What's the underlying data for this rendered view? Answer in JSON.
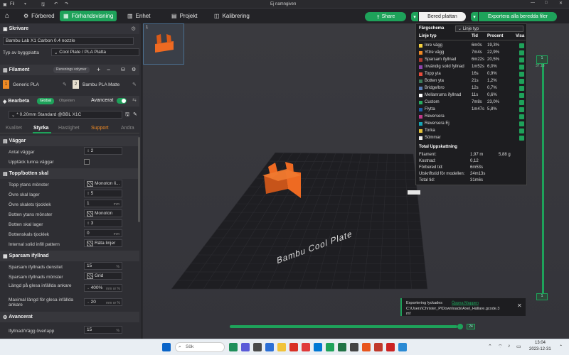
{
  "titlebar": {
    "menu": "Fil",
    "title": "Ej namngiven"
  },
  "toolbar": {
    "prepare": "Förbered",
    "preview": "Förhandsvisning",
    "device": "Enhet",
    "project": "Projekt",
    "calibration": "Kalibrering",
    "share": "Share",
    "slice": "Bered plattan",
    "export": "Exportera alla beredda filer"
  },
  "printer": {
    "header": "Skrivare",
    "model": "Bambu Lab X1 Carbon 0.4 nozzle",
    "plate_label": "Typ av byggplatta",
    "plate_value": "Cool Plate / PLA Platta"
  },
  "filament": {
    "header": "Filament",
    "flush_btn": "Rensnings volymer",
    "slots": [
      {
        "num": "1",
        "name": "Generic PLA",
        "color": "#f08a24"
      },
      {
        "num": "2",
        "name": "Bambu PLA Matte",
        "color": "#e8e0d0"
      }
    ]
  },
  "process": {
    "header": "Bearbeta",
    "global": "Global",
    "objects": "Objekten",
    "advanced": "Avancerat",
    "profile": "* 0.20mm Standard @BBL X1C",
    "tabs": [
      "Kvalitet",
      "Styrka",
      "Hastighet",
      "Support",
      "Andra"
    ]
  },
  "settings": {
    "walls": {
      "header": "Väggar",
      "wall_count_label": "Antal väggar",
      "wall_count": "2",
      "detect_thin_label": "Upptäck tunna väggar"
    },
    "topbottom": {
      "header": "Topp/botten skal",
      "top_pattern_label": "Topp ytans mönster",
      "top_pattern": "Monoton li...",
      "top_layers_label": "Övre skal lager",
      "top_layers": "5",
      "top_thick_label": "Övre skalets tjocklek",
      "top_thick": "1",
      "bottom_pattern_label": "Botten ytans mönster",
      "bottom_pattern": "Monoton",
      "bottom_layers_label": "Botten skal lager",
      "bottom_layers": "3",
      "bottom_thick_label": "Bottenskals tjocklek",
      "bottom_thick": "0",
      "internal_label": "Internal solid infill pattern",
      "internal": "Räta linjer",
      "unit_mm": "mm"
    },
    "infill": {
      "header": "Sparsam ifyllnad",
      "density_label": "Sparsam ifyllnads densitet",
      "density": "15",
      "density_unit": "%",
      "pattern_label": "Sparsam ifyllnads mönster",
      "pattern": "Grid",
      "anchor_label": "Längd på glesa infällda ankare",
      "anchor": "400%",
      "anchor_unit": "mm or %",
      "maxanchor_label": "Maximal längd för glesa infällda ankare",
      "maxanchor": "20",
      "maxanchor_unit": "mm or %"
    },
    "advanced": {
      "header": "Avancerat",
      "overlap_label": "Ifyllnad/Vägg överlapp",
      "overlap": "15",
      "overlap_unit": "%"
    }
  },
  "viewport": {
    "plate_num": "1",
    "bed_text": "Bambu Cool Plate",
    "layer_top": "1",
    "layer_top_h": "37.18",
    "layer_bottom": "1",
    "slider_value": "24",
    "export_notice": "Exportering lyckades",
    "export_link": "Öppna Mappen",
    "export_path": "C:\\Users\\Christer_P\\Downloads\\Axel_Hällare.gcode.3mf"
  },
  "legend": {
    "title": "Färgschema",
    "scheme": "Linje typ",
    "cols": [
      "Linje typ",
      "Tid",
      "Procent",
      "Visa"
    ],
    "rows": [
      {
        "name": "Inre vägg",
        "time": "6m0s",
        "pct": "19,3%",
        "color": "#f4d03f"
      },
      {
        "name": "Yttre vägg",
        "time": "7m4s",
        "pct": "22,9%",
        "color": "#f08a24"
      },
      {
        "name": "Sparsam ifyllnad",
        "time": "6m22s",
        "pct": "20,5%",
        "color": "#b03a2e"
      },
      {
        "name": "Invändig solid fyllnad",
        "time": "1m52s",
        "pct": "6,0%",
        "color": "#8e44ad"
      },
      {
        "name": "Topp yta",
        "time": "16s",
        "pct": "0,9%",
        "color": "#e74c3c"
      },
      {
        "name": "Botten yta",
        "time": "21s",
        "pct": "1,2%",
        "color": "#3d7a5a"
      },
      {
        "name": "Bridge/bro",
        "time": "12s",
        "pct": "0,7%",
        "color": "#5b7fb8"
      },
      {
        "name": "Mellanrums ifyllnad",
        "time": "11s",
        "pct": "0,6%",
        "color": "#ffffff"
      },
      {
        "name": "Custom",
        "time": "7m8s",
        "pct": "23,0%",
        "color": "#27ae60"
      },
      {
        "name": "Flytta",
        "time": "1m47s",
        "pct": "5,8%",
        "color": "#1f5fa8"
      },
      {
        "name": "Reversera",
        "time": "",
        "pct": "",
        "color": "#c0398b"
      },
      {
        "name": "Reversera Ej",
        "time": "",
        "pct": "",
        "color": "#17a5b5"
      },
      {
        "name": "Torka",
        "time": "",
        "pct": "",
        "color": "#e5c33a"
      },
      {
        "name": "Sömmar",
        "time": "",
        "pct": "",
        "color": "#e8e8e8"
      }
    ],
    "summary_title": "Total Uppskattning",
    "summary": [
      {
        "label": "Filament:",
        "v1": "1,97 m",
        "v2": "5,88 g"
      },
      {
        "label": "Kostnad:",
        "v1": "0,12",
        "v2": ""
      },
      {
        "label": "Förbered tid:",
        "v1": "6m53s",
        "v2": ""
      },
      {
        "label": "Utskriftstid för modellen:",
        "v1": "24m13s",
        "v2": ""
      },
      {
        "label": "Total tid:",
        "v1": "31m6s",
        "v2": ""
      }
    ]
  },
  "taskbar": {
    "search": "Sök",
    "time": "13:04",
    "date": "2023-12-31"
  },
  "colors": {
    "accent": "#1ea25a",
    "part": "#ee6a22"
  }
}
